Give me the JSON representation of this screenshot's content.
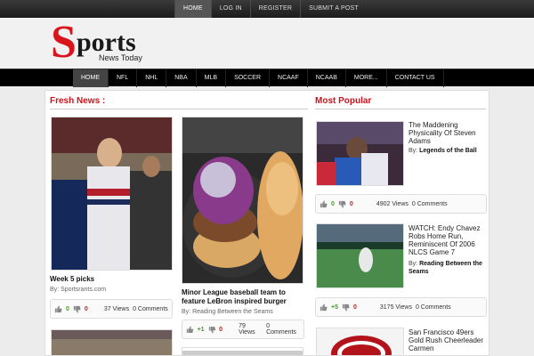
{
  "topnav": [
    {
      "label": "HOME",
      "active": true
    },
    {
      "label": "LOG IN"
    },
    {
      "label": "REGISTER"
    },
    {
      "label": "SUBMIT A POST"
    }
  ],
  "logo": {
    "s": "S",
    "rest": "ports",
    "tagline": "News Today"
  },
  "mainnav": [
    {
      "label": "HOME",
      "active": true
    },
    {
      "label": "NFL"
    },
    {
      "label": "NHL"
    },
    {
      "label": "NBA"
    },
    {
      "label": "MLB"
    },
    {
      "label": "SOCCER"
    },
    {
      "label": "NCAAF"
    },
    {
      "label": "NCAAB"
    },
    {
      "label": "MORE..."
    },
    {
      "label": "CONTACT US"
    }
  ],
  "fresh": {
    "title": "Fresh News :",
    "posts": [
      {
        "title": "Week 5 picks",
        "by": "By:",
        "author": "Sportsrants.com",
        "up": "0",
        "down": "0",
        "views": "37 Views",
        "comments": "0 Comments"
      },
      {
        "title": "Minor League baseball team to feature LeBron inspired burger",
        "by": "By:",
        "author": "Reading Between the Seams",
        "up": "+1",
        "down": "0",
        "views": "79 Views",
        "comments": "0 Comments"
      }
    ]
  },
  "popular": {
    "title": "Most Popular",
    "items": [
      {
        "title": "The Maddening Physicality Of Steven Adams",
        "by": "By:",
        "author": "Legends of the Ball",
        "up": "0",
        "down": "0",
        "views": "4902 Views",
        "comments": "0 Comments"
      },
      {
        "title": "WATCH: Endy Chavez Robs Home Run, Reminiscent Of 2006 NLCS Game 7",
        "by": "By:",
        "author": "Reading Between the Seams",
        "up": "+5",
        "down": "0",
        "views": "3175 Views",
        "comments": "0 Comments"
      },
      {
        "title": "San Francisco 49ers Gold Rush Cheerleader Carmen"
      }
    ]
  },
  "colors": {
    "accent": "#d0101a",
    "nav_bg": "#000000",
    "up": "#4a9a2c",
    "down": "#c51a1a"
  },
  "icons": [
    "thumbs-up-icon",
    "thumbs-down-icon"
  ]
}
